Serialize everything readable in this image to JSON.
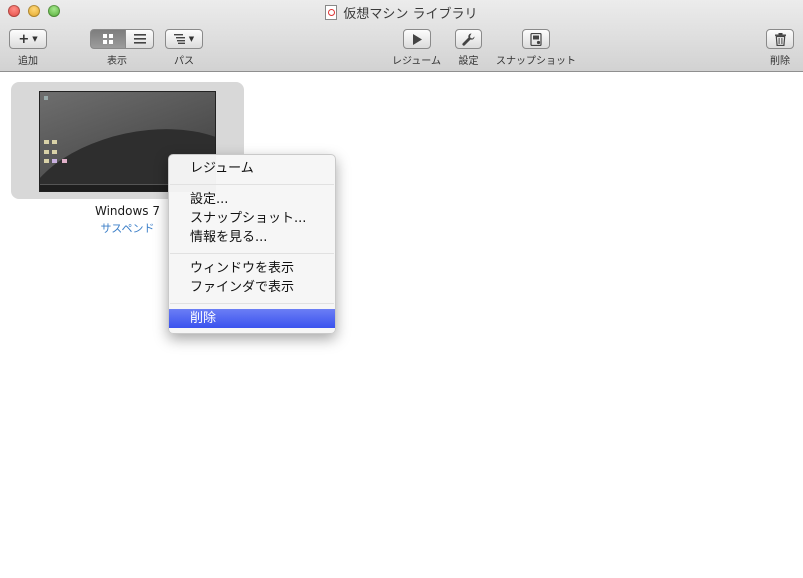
{
  "window": {
    "title": "仮想マシン ライブラリ"
  },
  "toolbar": {
    "add_label": "追加",
    "view_label": "表示",
    "path_label": "パス",
    "resume_label": "レジューム",
    "settings_label": "設定",
    "snapshot_label": "スナップショット",
    "delete_label": "削除"
  },
  "vm": {
    "name": "Windows 7",
    "status": "サスペンド"
  },
  "context_menu": {
    "items": [
      {
        "label": "レジューム"
      },
      {
        "label": "設定..."
      },
      {
        "label": "スナップショット..."
      },
      {
        "label": "情報を見る..."
      },
      {
        "label": "ウィンドウを表示"
      },
      {
        "label": "ファインダで表示"
      },
      {
        "label": "削除"
      }
    ],
    "selected_label": "削除"
  },
  "colors": {
    "status_text": "#3c7fc8",
    "menu_highlight": "#3a52ee"
  }
}
